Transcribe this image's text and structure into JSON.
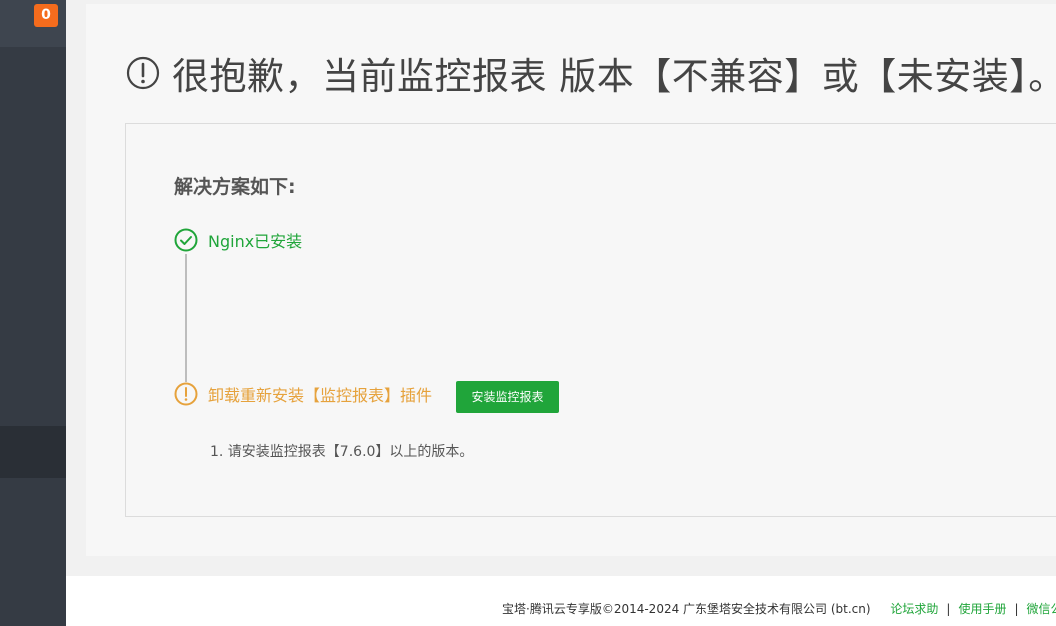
{
  "sidebar": {
    "badge_count": "0"
  },
  "headline": {
    "text": "很抱歉，当前监控报表 版本【不兼容】或【未安装】。"
  },
  "solution": {
    "title": "解决方案如下:",
    "steps": [
      {
        "label": "Nginx已安装",
        "status": "success",
        "status_color": "#20a53a"
      },
      {
        "label": "卸载重新安装【监控报表】插件",
        "status": "warning",
        "status_color": "#e6a23c",
        "button_label": "安装监控报表",
        "note": "1. 请安装监控报表【7.6.0】以上的版本。"
      }
    ]
  },
  "footer": {
    "copyright": "宝塔·腾讯云专享版©2014-2024 广东堡塔安全技术有限公司 (bt.cn)",
    "links": [
      "论坛求助",
      "使用手册",
      "微信公众号"
    ]
  },
  "colors": {
    "accent": "#20a53a",
    "warning": "#e6a23c",
    "badge": "#f56c1d",
    "sidebar": "#353b44"
  }
}
